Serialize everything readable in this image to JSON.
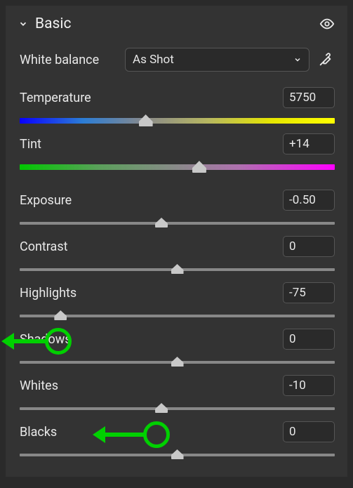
{
  "panel": {
    "title": "Basic"
  },
  "whiteBalance": {
    "label": "White balance",
    "value": "As Shot"
  },
  "params": {
    "temperature": {
      "label": "Temperature",
      "value": "5750",
      "position": 40
    },
    "tint": {
      "label": "Tint",
      "value": "+14",
      "position": 57
    },
    "exposure": {
      "label": "Exposure",
      "value": "-0.50",
      "position": 45
    },
    "contrast": {
      "label": "Contrast",
      "value": "0",
      "position": 50
    },
    "highlights": {
      "label": "Highlights",
      "value": "-75",
      "position": 13
    },
    "shadows": {
      "label": "Shadows",
      "value": "0",
      "position": 50
    },
    "whites": {
      "label": "Whites",
      "value": "-10",
      "position": 45
    },
    "blacks": {
      "label": "Blacks",
      "value": "0",
      "position": 50
    }
  }
}
